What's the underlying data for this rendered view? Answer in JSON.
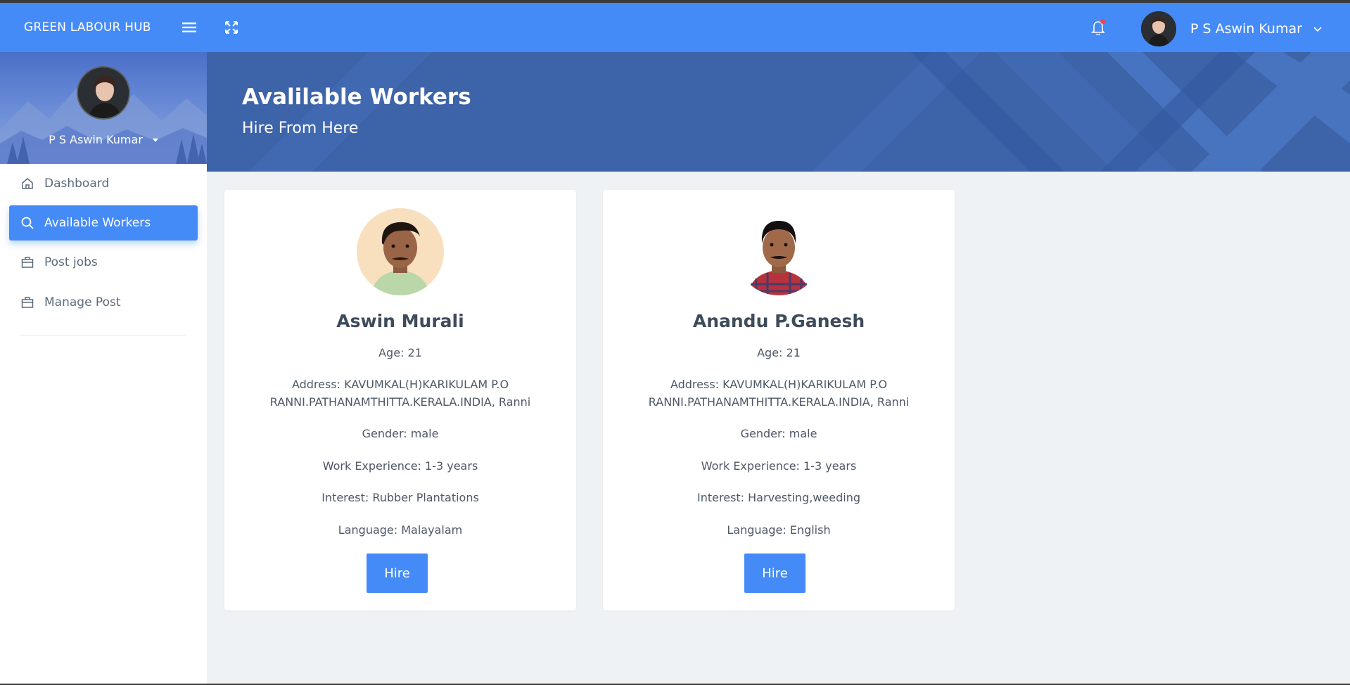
{
  "navbar": {
    "brand": "GREEN LABOUR HUB",
    "user_name": "P S Aswin Kumar",
    "icons": [
      "menu-icon",
      "fullscreen-icon",
      "bell-icon",
      "chevron-down-icon"
    ],
    "notification_dot_color": "#f1434f"
  },
  "sidebar": {
    "profile_name": "P S Aswin Kumar",
    "items": [
      {
        "label": "Dashboard",
        "icon": "home-icon",
        "active": false
      },
      {
        "label": "Available Workers",
        "icon": "search-icon",
        "active": true
      },
      {
        "label": "Post jobs",
        "icon": "briefcase-icon",
        "active": false
      },
      {
        "label": "Manage Post",
        "icon": "briefcase-icon",
        "active": false
      }
    ]
  },
  "hero": {
    "title": "Avalilable Workers",
    "subtitle": "Hire From Here"
  },
  "workers": [
    {
      "name": "Aswin Murali",
      "age": "Age: 21",
      "address_line1": "Address: KAVUMKAL(H)KARIKULAM P.O",
      "address_line2": "RANNI.PATHANAMTHITTA.KERALA.INDIA, Ranni",
      "gender": "Gender: male",
      "experience": "Work Experience: 1-3 years",
      "interest": "Interest: Rubber Plantations",
      "language": "Language: Malayalam",
      "hire_label": "Hire"
    },
    {
      "name": "Anandu P.Ganesh",
      "age": "Age: 21",
      "address_line1": "Address: KAVUMKAL(H)KARIKULAM P.O",
      "address_line2": "RANNI.PATHANAMTHITTA.KERALA.INDIA, Ranni",
      "gender": "Gender: male",
      "experience": "Work Experience: 1-3 years",
      "interest": "Interest: Harvesting,weeding",
      "language": "Language: English",
      "hire_label": "Hire"
    }
  ],
  "colors": {
    "primary": "#458bf8",
    "hero_bg": "#3d63a8",
    "content_bg": "#eef2f5"
  }
}
